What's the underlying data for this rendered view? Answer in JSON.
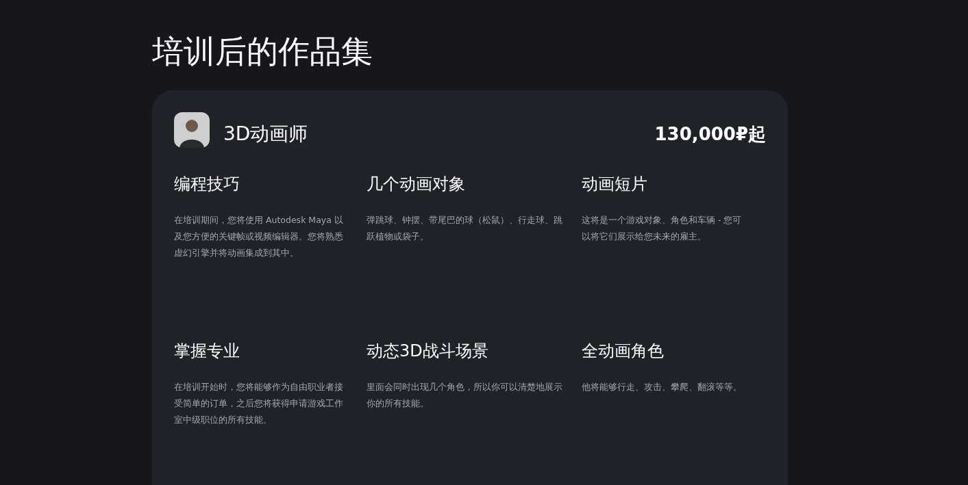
{
  "title": "培训后的作品集",
  "card": {
    "role": "3D动画师",
    "price": "130,000₽起",
    "items": [
      {
        "heading": "编程技巧",
        "text": "在培训期间，您将使用 Autodesk Maya 以及您方便的关键帧或视频编辑器。您将熟悉虚幻引擎并将动画集成到其中。"
      },
      {
        "heading": "几个动画对象",
        "text": "弹跳球、钟摆、带尾巴的球（松鼠）、行走球、跳跃植物或袋子。"
      },
      {
        "heading": "动画短片",
        "text": "这将是一个游戏对象、角色和车辆 - 您可以将它们展示给您未来的雇主。"
      },
      {
        "heading": "掌握专业",
        "text": "在培训开始时，您将能够作为自由职业者接受简单的订单，之后您将获得申请游戏工作室中级职位的所有技能。"
      },
      {
        "heading": "动态3D战斗场景",
        "text": "里面会同时出现几个角色，所以你可以清楚地展示你的所有技能。"
      },
      {
        "heading": "全动画角色",
        "text": "他将能够行走、攻击、攀爬、翻滚等等。"
      }
    ]
  }
}
